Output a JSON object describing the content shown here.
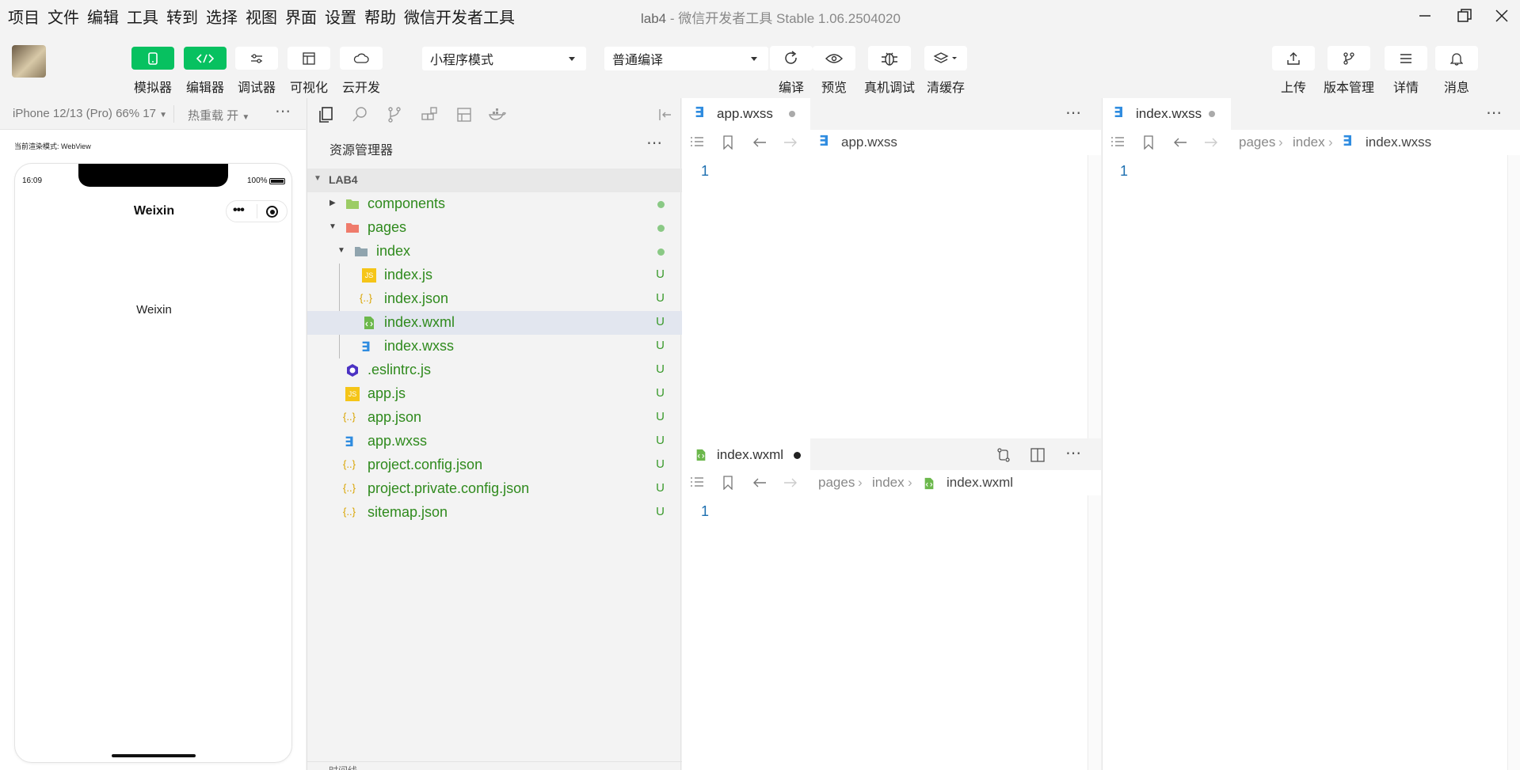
{
  "menu": [
    "项目",
    "文件",
    "编辑",
    "工具",
    "转到",
    "选择",
    "视图",
    "界面",
    "设置",
    "帮助",
    "微信开发者工具"
  ],
  "window": {
    "project": "lab4",
    "separator": "-",
    "app_title": "微信开发者工具 Stable 1.06.2504020"
  },
  "toolbar": {
    "simulator": "模拟器",
    "editor": "编辑器",
    "debugger": "调试器",
    "visual": "可视化",
    "cloud": "云开发",
    "mode_select": "小程序模式",
    "compile_select": "普通编译",
    "compile": "编译",
    "preview": "预览",
    "remote_debug": "真机调试",
    "clear_cache": "清缓存",
    "upload": "上传",
    "version": "版本管理",
    "details": "详情",
    "messages": "消息",
    "accent": "#07c160"
  },
  "sim": {
    "device": "iPhone 12/13 (Pro) 66% 17",
    "hot_reload": "热重载 开",
    "render_mode": "当前渲染模式: WebView",
    "time": "16:09",
    "battery": "100%",
    "nav_title": "Weixin",
    "body_text": "Weixin"
  },
  "explorer": {
    "title": "资源管理器",
    "root": "LAB4",
    "items": [
      {
        "name": "components",
        "status": "dot"
      },
      {
        "name": "pages",
        "status": "dot"
      },
      {
        "name": "index",
        "status": "dot"
      },
      {
        "name": "index.js",
        "status": "U"
      },
      {
        "name": "index.json",
        "status": "U"
      },
      {
        "name": "index.wxml",
        "status": "U"
      },
      {
        "name": "index.wxss",
        "status": "U"
      },
      {
        "name": ".eslintrc.js",
        "status": "U"
      },
      {
        "name": "app.js",
        "status": "U"
      },
      {
        "name": "app.json",
        "status": "U"
      },
      {
        "name": "app.wxss",
        "status": "U"
      },
      {
        "name": "project.config.json",
        "status": "U"
      },
      {
        "name": "project.private.config.json",
        "status": "U"
      },
      {
        "name": "sitemap.json",
        "status": "U"
      }
    ],
    "bottom_label": "时间线"
  },
  "editors": {
    "left_top": {
      "tab": "app.wxss",
      "crumb_file": "app.wxss",
      "line": "1"
    },
    "left_bottom": {
      "tab": "index.wxml",
      "crumb_1": "pages",
      "crumb_2": "index",
      "crumb_file": "index.wxml",
      "line": "1"
    },
    "right": {
      "tab": "index.wxss",
      "crumb_1": "pages",
      "crumb_2": "index",
      "crumb_file": "index.wxss",
      "line": "1"
    },
    "more": "⋯"
  }
}
